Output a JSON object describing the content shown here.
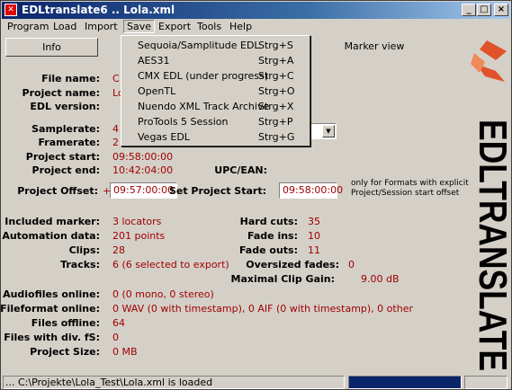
{
  "window": {
    "title": "EDLtranslate6 .. Lola.xml",
    "minimize": "_",
    "maximize": "□",
    "close": "×"
  },
  "menu": [
    "Program",
    "Load",
    "Import",
    "Save",
    "Export",
    "Tools",
    "Help"
  ],
  "tabs": {
    "info": "Info",
    "marker": "Marker view"
  },
  "save_menu": [
    {
      "label": "Sequoia/Samplitude EDL",
      "shortcut": "Strg+S"
    },
    {
      "label": "AES31",
      "shortcut": "Strg+A"
    },
    {
      "label": "CMX EDL (under progress)",
      "shortcut": "Strg+C"
    },
    {
      "label": "OpenTL",
      "shortcut": "Strg+O"
    },
    {
      "label": "Nuendo XML Track Archive",
      "shortcut": "Strg+X"
    },
    {
      "label": "ProTools 5 Session",
      "shortcut": "Strg+P"
    },
    {
      "label": "Vegas EDL",
      "shortcut": "Strg+G"
    }
  ],
  "info": {
    "file_name_label": "File name:",
    "file_name_value": "C",
    "project_name_label": "Project name:",
    "project_name_value": "Lo",
    "edl_version_label": "EDL version:",
    "samplerate_label": "Samplerate:",
    "samplerate_value": "4",
    "framerate_label": "Framerate:",
    "framerate_value": "2",
    "project_start_label": "Project start:",
    "project_start_value": "09:58:00:00",
    "project_end_label": "Project end:",
    "project_end_value": "10:42:04:00",
    "upc_label": "UPC/EAN:",
    "project_offset_label": "Project Offset:",
    "project_offset_sign": "+",
    "project_offset_value": "09:57:00:00",
    "set_project_start_label": "Set Project Start:",
    "set_project_start_value": "09:58:00:00",
    "offset_note_1": "only for Formats with explicit",
    "offset_note_2": "Project/Session start offset"
  },
  "stats": {
    "included_marker_label": "Included marker:",
    "included_marker_value": "3 locators",
    "automation_label": "Automation data:",
    "automation_value": "201 points",
    "clips_label": "Clips:",
    "clips_value": "28",
    "tracks_label": "Tracks:",
    "tracks_value": "6 (6 selected to export)",
    "hard_cuts_label": "Hard cuts:",
    "hard_cuts_value": "35",
    "fade_ins_label": "Fade ins:",
    "fade_ins_value": "10",
    "fade_outs_label": "Fade outs:",
    "fade_outs_value": "11",
    "oversized_label": "Oversized fades:",
    "oversized_value": "0",
    "max_gain_label": "Maximal Clip Gain:",
    "max_gain_value": "9.00 dB"
  },
  "audio": {
    "online_label": "Audiofiles online:",
    "online_value": "0 (0 mono, 0 stereo)",
    "format_label": "Fileformat online:",
    "format_value": "0 WAV (0 with timestamp), 0 AIF (0 with timestamp), 0 other",
    "offline_label": "Files offline:",
    "offline_value": "64",
    "divfs_label": "Files with div. fS:",
    "divfs_value": "0",
    "size_label": "Project Size:",
    "size_value": "0 MB"
  },
  "logo": {
    "text": "EDLTRANSLATE"
  },
  "status": {
    "text": "... C:\\Projekte\\Lola_Test\\Lola.xml is loaded",
    "progress": 1.0
  },
  "colors": {
    "accent_value": "#a00000",
    "title_gradient_start": "#0a246a",
    "logo_red": "#e0522a"
  }
}
